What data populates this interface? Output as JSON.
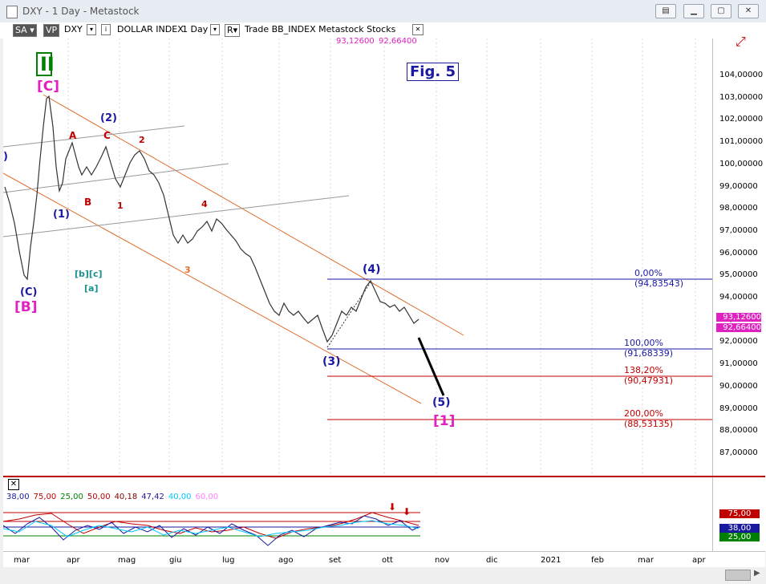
{
  "window": {
    "title": "DXY - 1 Day - Metastock"
  },
  "toolbar": {
    "sa": "SA",
    "vp": "VP",
    "symbol": "DXY",
    "name": "DOLLAR INDEX",
    "period": "1 Day",
    "r_btn": "R",
    "feed": "Trade  BB_INDEX  Metastock  Stocks",
    "close_x": "✕",
    "val1": "93,12600",
    "val2": "92,66400"
  },
  "fig_label": "Fig. 5",
  "y_axis": [
    "104,00000",
    "103,00000",
    "102,00000",
    "101,00000",
    "100,00000",
    "99,00000",
    "98,00000",
    "97,00000",
    "96,00000",
    "95,00000",
    "94,00000",
    "93,00000",
    "92,00000",
    "91,00000",
    "90,00000",
    "89,00000",
    "88,00000",
    "87,00000"
  ],
  "price_tags": {
    "last_high": "93,12600",
    "last_low": "92,66400"
  },
  "fib_levels": [
    {
      "label": "0,00% (94,83543)",
      "price": 94.83543
    },
    {
      "label": "100,00% (91,68339)",
      "price": 91.68339
    },
    {
      "label": "138,20% (90,47931)",
      "price": 90.47931
    },
    {
      "label": "200,00% (88,53135)",
      "price": 88.53135
    }
  ],
  "wave_labels": {
    "II": "II",
    "C_big": "[C]",
    "B_big": "[B]",
    "C_paren": "(C)",
    "one_paren": "(1)",
    "two_paren": "(2)",
    "A": "A",
    "B": "B",
    "C": "C",
    "two": "2",
    "one": "1",
    "four": "4",
    "three": "3",
    "bc": "[b][c]",
    "a_br": "[a]",
    "four_paren": "(4)",
    "three_paren": "(3)",
    "five_paren": "(5)",
    "one_big": "[1]",
    "left_paren": ")"
  },
  "indicator": {
    "params": [
      "38,00",
      "75,00",
      "25,00",
      "50,00",
      "40,18",
      "47,42",
      "40,00",
      "60,00"
    ],
    "param_colors": [
      "#1a1aa0",
      "#c00000",
      "#008000",
      "#c00000",
      "#800000",
      "#1a1aa0",
      "#00c8ff",
      "#ff80ff"
    ],
    "axis_tags": [
      "75,00",
      "38,00",
      "25,00"
    ]
  },
  "x_axis": [
    "mar",
    "apr",
    "mag",
    "giu",
    "lug",
    "ago",
    "set",
    "ott",
    "nov",
    "dic",
    "2021",
    "feb",
    "mar",
    "apr"
  ],
  "colors": {
    "channel": "#e07030",
    "wave_blue": "#1a1aa0",
    "wave_red": "#c00000",
    "magenta": "#e020c0",
    "green_box": "#008000"
  }
}
